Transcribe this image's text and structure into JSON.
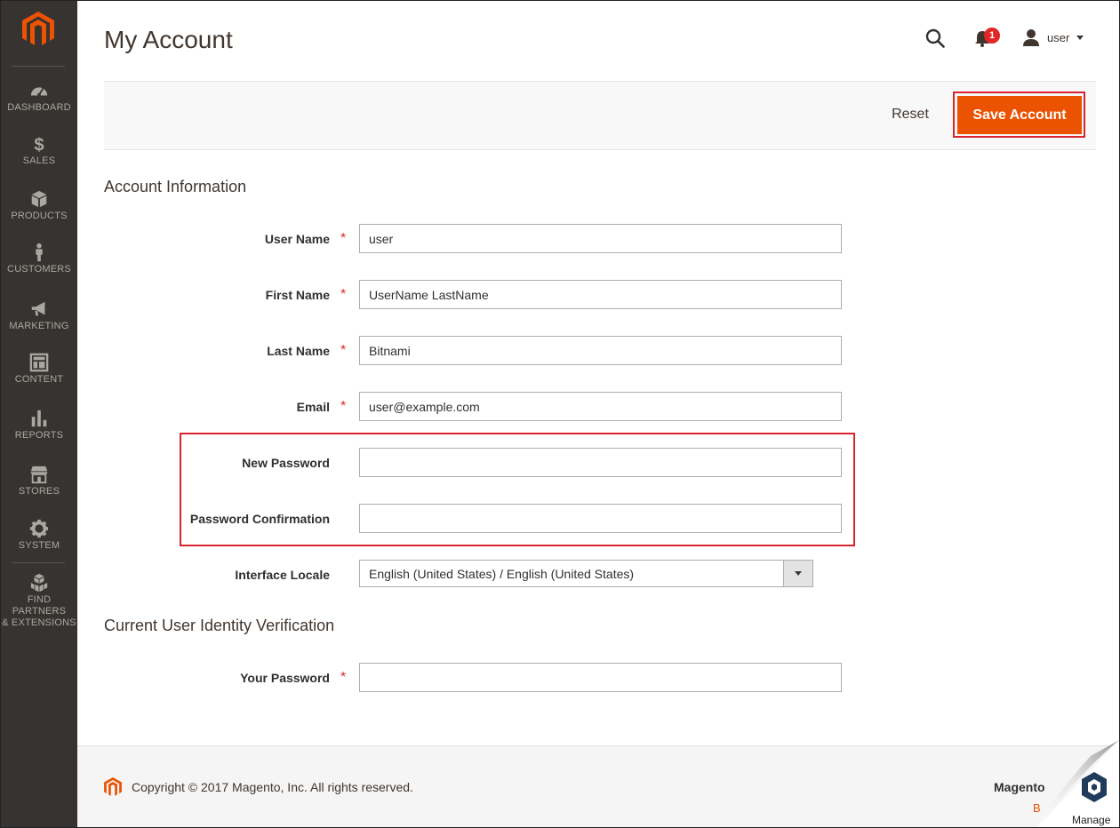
{
  "sidebar": {
    "logo_icon": "magento-logo-icon",
    "items": [
      {
        "label": "DASHBOARD",
        "icon": "dashboard-gauge-icon"
      },
      {
        "label": "SALES",
        "icon": "dollar-icon"
      },
      {
        "label": "PRODUCTS",
        "icon": "box-icon"
      },
      {
        "label": "CUSTOMERS",
        "icon": "person-icon"
      },
      {
        "label": "MARKETING",
        "icon": "megaphone-icon"
      },
      {
        "label": "CONTENT",
        "icon": "layout-icon"
      },
      {
        "label": "REPORTS",
        "icon": "bar-chart-icon"
      },
      {
        "label": "STORES",
        "icon": "storefront-icon"
      },
      {
        "label": "SYSTEM",
        "icon": "gear-icon"
      },
      {
        "label_line1": "FIND PARTNERS",
        "label_line2": "& EXTENSIONS",
        "icon": "cubes-icon"
      }
    ]
  },
  "header": {
    "title": "My Account",
    "notification_count": "1",
    "user_name": "user"
  },
  "actions": {
    "reset_label": "Reset",
    "save_label": "Save Account"
  },
  "account_info": {
    "section_title": "Account Information",
    "user_name": {
      "label": "User Name",
      "value": "user",
      "required_mark": "*"
    },
    "first_name": {
      "label": "First Name",
      "value": "UserName LastName",
      "required_mark": "*"
    },
    "last_name": {
      "label": "Last Name",
      "value": "Bitnami",
      "required_mark": "*"
    },
    "email": {
      "label": "Email",
      "value": "user@example.com",
      "required_mark": "*"
    },
    "new_password": {
      "label": "New Password",
      "value": ""
    },
    "password_confirmation": {
      "label": "Password Confirmation",
      "value": ""
    },
    "interface_locale": {
      "label": "Interface Locale",
      "value": "English (United States) / English (United States)"
    }
  },
  "verification": {
    "section_title": "Current User Identity Verification",
    "your_password": {
      "label": "Your Password",
      "value": "",
      "required_mark": "*"
    }
  },
  "footer": {
    "copyright": "Copyright © 2017 Magento, Inc. All rights reserved.",
    "brand": "Magento",
    "version_fragment": "B",
    "badge_text": "Manage"
  },
  "colors": {
    "sidebar_bg": "#373330",
    "accent_orange": "#eb5202",
    "highlight_red": "#d9232e"
  }
}
